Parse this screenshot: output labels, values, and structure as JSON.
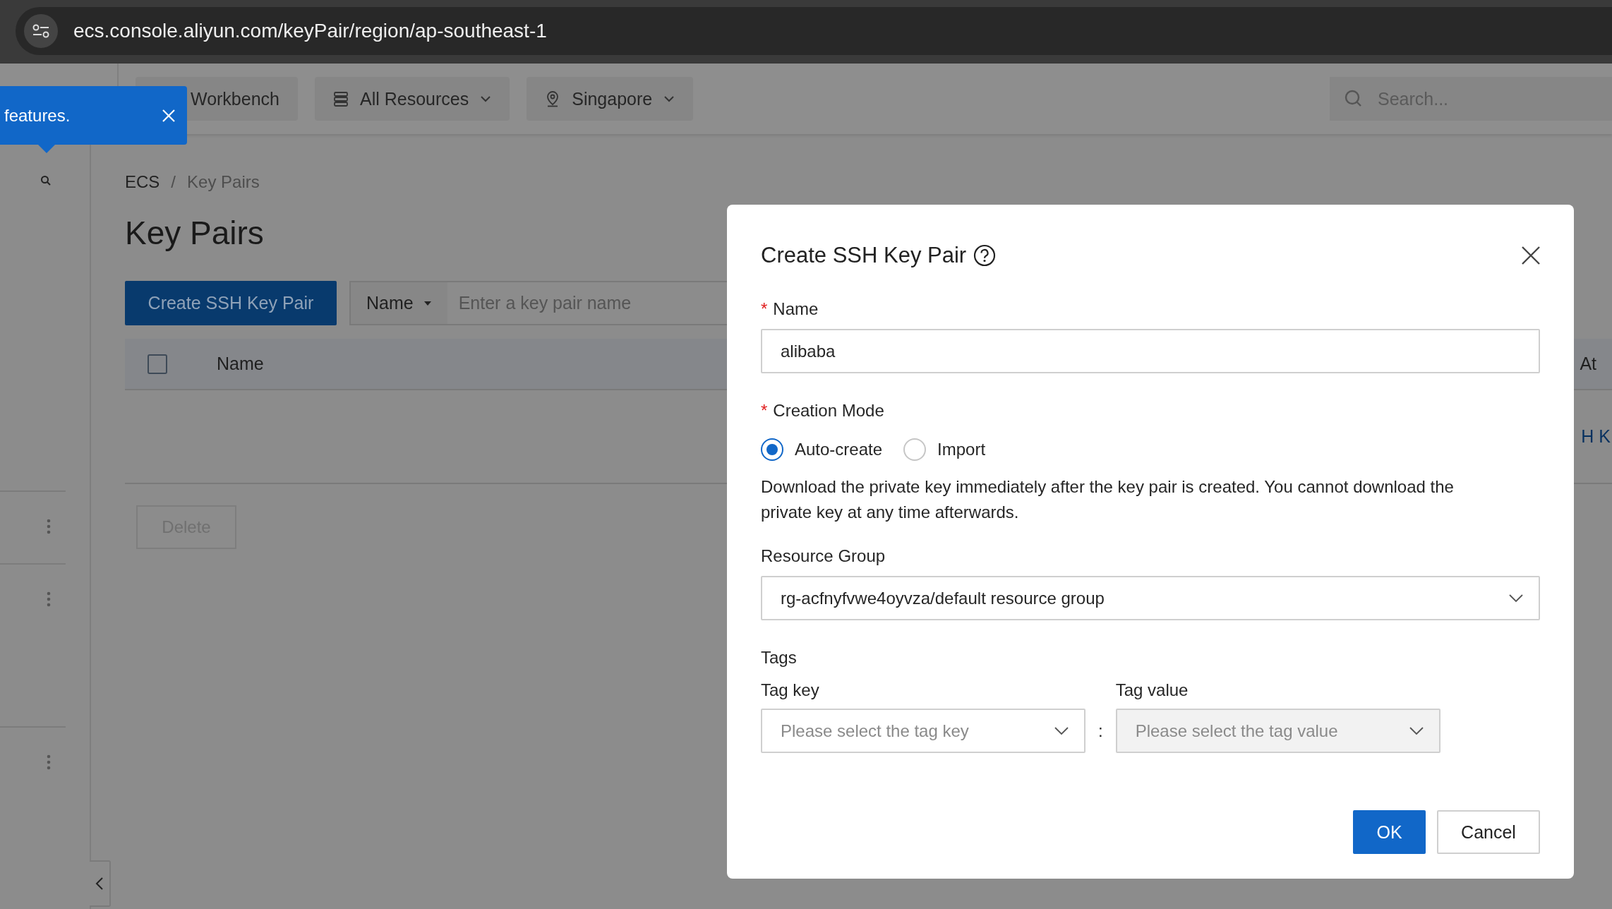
{
  "browser": {
    "url": "ecs.console.aliyun.com/keyPair/region/ap-southeast-1"
  },
  "top_nav": {
    "items": [
      {
        "label": "Workbench",
        "kind": "plain"
      },
      {
        "label": "All Resources",
        "kind": "resources"
      },
      {
        "label": "Singapore",
        "kind": "region"
      }
    ],
    "search": {
      "placeholder": "Search..."
    }
  },
  "tooltip": {
    "text": "features."
  },
  "breadcrumb": {
    "items": [
      "ECS",
      "Key Pairs"
    ],
    "separator": "/"
  },
  "page_title": "Key Pairs",
  "create_button": "Create SSH Key Pair",
  "filter": {
    "field": "Name",
    "placeholder": "Enter a key pair name"
  },
  "table": {
    "columns": [
      {
        "label": "Name"
      },
      {
        "label": "At"
      }
    ],
    "select_all": {
      "checked": false
    },
    "link": "H K"
  },
  "delete_button": {
    "label": "Delete",
    "disabled": true
  },
  "dialog": {
    "title": "Create SSH Key Pair",
    "name": {
      "label": "Name",
      "required_mark": "*",
      "value": "alibaba"
    },
    "creation_mode": {
      "label": "Creation Mode",
      "required_mark": "*",
      "options": [
        {
          "label": "Auto-create",
          "selected": true
        },
        {
          "label": "Import",
          "selected": false
        }
      ]
    },
    "note": "Download the private key immediately after the key pair is created. You cannot download the private key at any time afterwards.",
    "resource_group": {
      "label": "Resource Group",
      "value": "rg-acfnyfvwe4oyvza/default resource group"
    },
    "tags": {
      "label": "Tags",
      "key": {
        "label": "Tag key",
        "placeholder": "Please select the tag key",
        "disabled": false
      },
      "separator": ":",
      "value": {
        "label": "Tag value",
        "placeholder": "Please select the tag value",
        "disabled": true
      }
    },
    "buttons": [
      {
        "label": "OK",
        "kind": "primary"
      },
      {
        "label": "Cancel",
        "kind": "secondary"
      }
    ]
  }
}
